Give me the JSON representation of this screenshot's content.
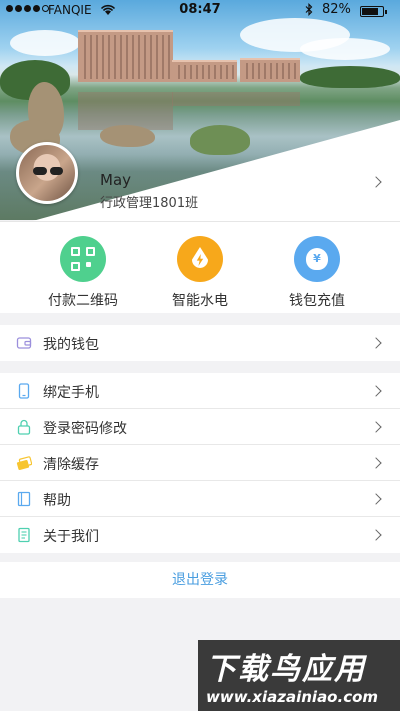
{
  "status_bar": {
    "carrier": "FANQIE",
    "time": "08:47",
    "battery_percent": "82%",
    "battery_level": 0.82,
    "wifi_icon": "wifi-icon",
    "bluetooth_icon": "bluetooth-icon"
  },
  "profile": {
    "name": "May",
    "class_name": "行政管理1801班"
  },
  "quick_actions": [
    {
      "label": "付款二维码",
      "icon": "qr-code-icon",
      "color": "#4fd08e"
    },
    {
      "label": "智能水电",
      "icon": "water-electric-icon",
      "color": "#f7a81b"
    },
    {
      "label": "钱包充值",
      "icon": "money-bag-icon",
      "color": "#5aa9ef",
      "icon_glyph": "¥"
    }
  ],
  "wallet_group": [
    {
      "label": "我的钱包",
      "icon": "wallet-icon"
    }
  ],
  "settings_group": [
    {
      "label": "绑定手机",
      "icon": "phone-icon"
    },
    {
      "label": "登录密码修改",
      "icon": "lock-icon"
    },
    {
      "label": "清除缓存",
      "icon": "clear-cache-icon"
    },
    {
      "label": "帮助",
      "icon": "book-icon"
    },
    {
      "label": "关于我们",
      "icon": "document-icon"
    }
  ],
  "logout_label": "退出登录",
  "watermark": {
    "title": "下载鸟应用",
    "url": "www.xiazainiao.com"
  },
  "colors": {
    "accent": "#4a9ee0",
    "background": "#f2f2f4"
  }
}
